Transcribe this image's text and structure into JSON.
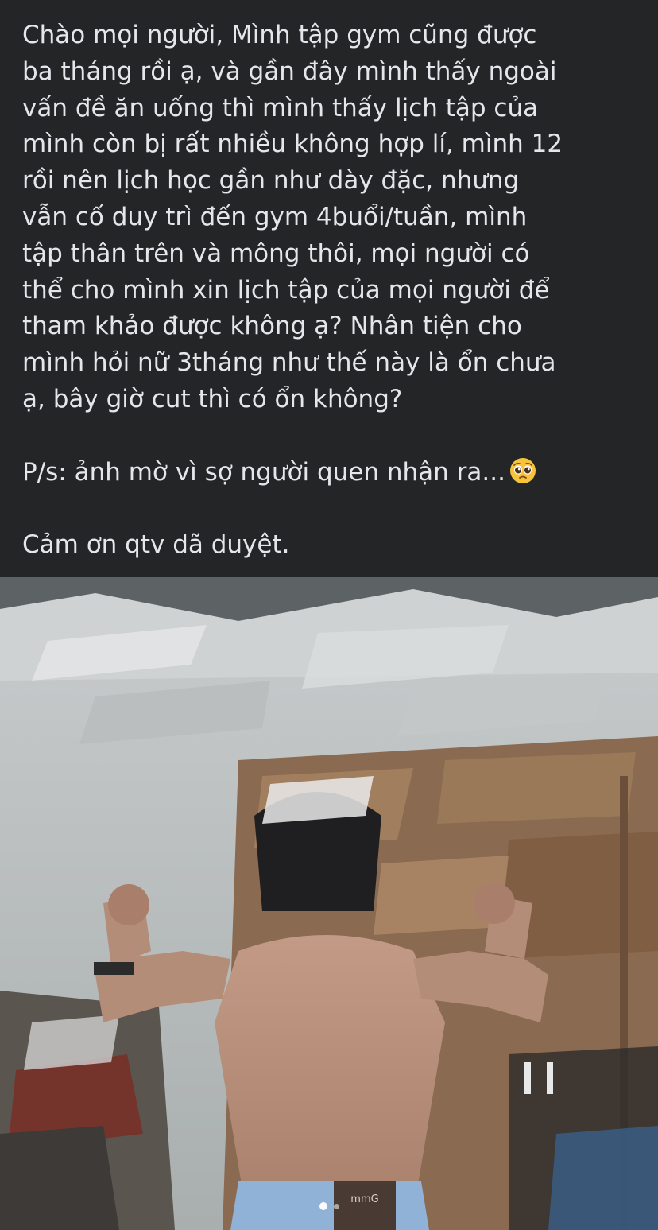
{
  "post": {
    "lines": [
      "Chào mọi người, Mình tập gym cũng được",
      "ba tháng rồi ạ, và gần đây mình thấy ngoài",
      "vấn đề ăn uống thì mình thấy lịch tập của",
      "mình còn bị rất nhiều không hợp lí, mình 12",
      "rồi nên lịch học gần như dày đặc, nhưng",
      "vẫn cố duy trì đến gym 4buổi/tuần, mình",
      "tập thân trên và mông thôi, mọi người có",
      "thể cho mình xin lịch tập của mọi người để",
      "tham khảo được không ạ? Nhân tiện cho",
      "mình hỏi nữ 3tháng như thế này là ổn chưa",
      "ạ, bây giờ cut thì có ổn không?"
    ],
    "ps": "P/s: ảnh mờ vì sợ người quen nhận ra...",
    "ps_emoji": "pleading-face-icon",
    "thanks": "Cảm ơn qtv dã duyệt."
  },
  "photo": {
    "description_icon": "photo-icon",
    "waistband_label": "mmG",
    "carousel": {
      "count": 2,
      "active": 1
    }
  },
  "colors": {
    "background": "#242526",
    "text": "#e4e6eb"
  }
}
